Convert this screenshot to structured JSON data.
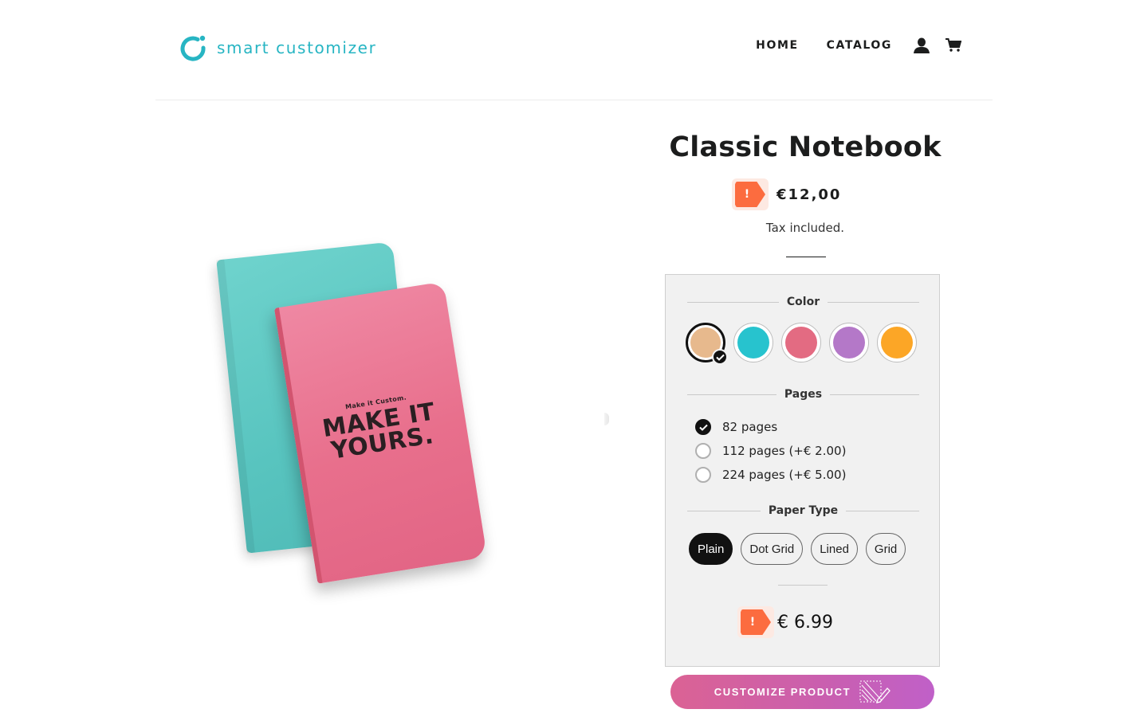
{
  "brand": {
    "name": "smart customizer",
    "color": "#27b5c3"
  },
  "nav": {
    "items": [
      {
        "label": "HOME"
      },
      {
        "label": "CATALOG"
      }
    ],
    "account_icon": "user-icon",
    "cart_icon": "cart-icon"
  },
  "product": {
    "title": "Classic Notebook",
    "price": "€12,00",
    "tax_note": "Tax included.",
    "warning_icon": "!",
    "image": {
      "caption_small": "Make it Custom.",
      "caption_big_line1": "MAKE IT",
      "caption_big_line2": "YOURS."
    }
  },
  "customizer": {
    "color": {
      "label": "Color",
      "selected_index": 0,
      "options": [
        {
          "name": "beige",
          "hex": "#e7b98d"
        },
        {
          "name": "turquoise",
          "hex": "#27c3ce"
        },
        {
          "name": "pink",
          "hex": "#e36b82"
        },
        {
          "name": "purple",
          "hex": "#b478c8"
        },
        {
          "name": "orange",
          "hex": "#fca626"
        }
      ]
    },
    "pages": {
      "label": "Pages",
      "selected_index": 0,
      "options": [
        {
          "label": "82 pages"
        },
        {
          "label": "112 pages (+€ 2.00)"
        },
        {
          "label": "224 pages (+€ 5.00)"
        }
      ]
    },
    "paper_type": {
      "label": "Paper Type",
      "selected_index": 0,
      "options": [
        {
          "label": "Plain"
        },
        {
          "label": "Dot Grid"
        },
        {
          "label": "Lined"
        },
        {
          "label": "Grid"
        }
      ]
    },
    "warning_icon": "!",
    "total": "€ 6.99"
  },
  "cta": {
    "label": "CUSTOMIZE PRODUCT",
    "icon": "customize-edit-icon"
  },
  "colors": {
    "warning": "#fc6c3f",
    "cta_gradient_start": "#db6294",
    "cta_gradient_end": "#c060c8"
  }
}
